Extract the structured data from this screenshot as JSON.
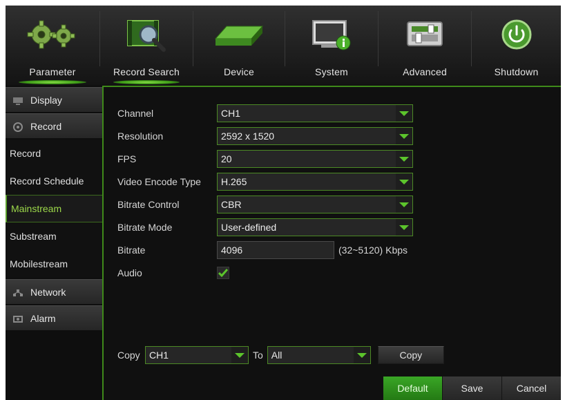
{
  "nav": [
    {
      "label": "Parameter",
      "icon": "gears-icon",
      "active": true
    },
    {
      "label": "Record Search",
      "icon": "film-search-icon",
      "active": false
    },
    {
      "label": "Device",
      "icon": "hard-drive-icon",
      "active": false
    },
    {
      "label": "System",
      "icon": "monitor-info-icon",
      "active": false
    },
    {
      "label": "Advanced",
      "icon": "advanced-panel-icon",
      "active": false
    },
    {
      "label": "Shutdown",
      "icon": "power-icon",
      "active": false
    }
  ],
  "sidebar": {
    "display": {
      "label": "Display",
      "icon": "monitor-icon"
    },
    "record": {
      "label": "Record",
      "icon": "film-reel-icon"
    },
    "record_sub": [
      {
        "label": "Record"
      },
      {
        "label": "Record Schedule"
      },
      {
        "label": "Mainstream",
        "active": true
      },
      {
        "label": "Substream"
      },
      {
        "label": "Mobilestream"
      }
    ],
    "network": {
      "label": "Network",
      "icon": "network-icon"
    },
    "alarm": {
      "label": "Alarm",
      "icon": "alarm-icon"
    }
  },
  "form": {
    "channel": {
      "label": "Channel",
      "value": "CH1"
    },
    "resolution": {
      "label": "Resolution",
      "value": "2592 x 1520"
    },
    "fps": {
      "label": "FPS",
      "value": "20"
    },
    "encode": {
      "label": "Video Encode Type",
      "value": "H.265"
    },
    "bitrate_control": {
      "label": "Bitrate Control",
      "value": "CBR"
    },
    "bitrate_mode": {
      "label": "Bitrate Mode",
      "value": "User-defined"
    },
    "bitrate": {
      "label": "Bitrate",
      "value": "4096",
      "hint": "(32~5120) Kbps"
    },
    "audio": {
      "label": "Audio",
      "checked": true
    }
  },
  "copy": {
    "label": "Copy",
    "from": "CH1",
    "to_label": "To",
    "to": "All",
    "button": "Copy"
  },
  "buttons": {
    "default": "Default",
    "save": "Save",
    "cancel": "Cancel"
  },
  "colors": {
    "accent": "#4fb02a",
    "active_text": "#9cd84a",
    "background": "#121212"
  }
}
